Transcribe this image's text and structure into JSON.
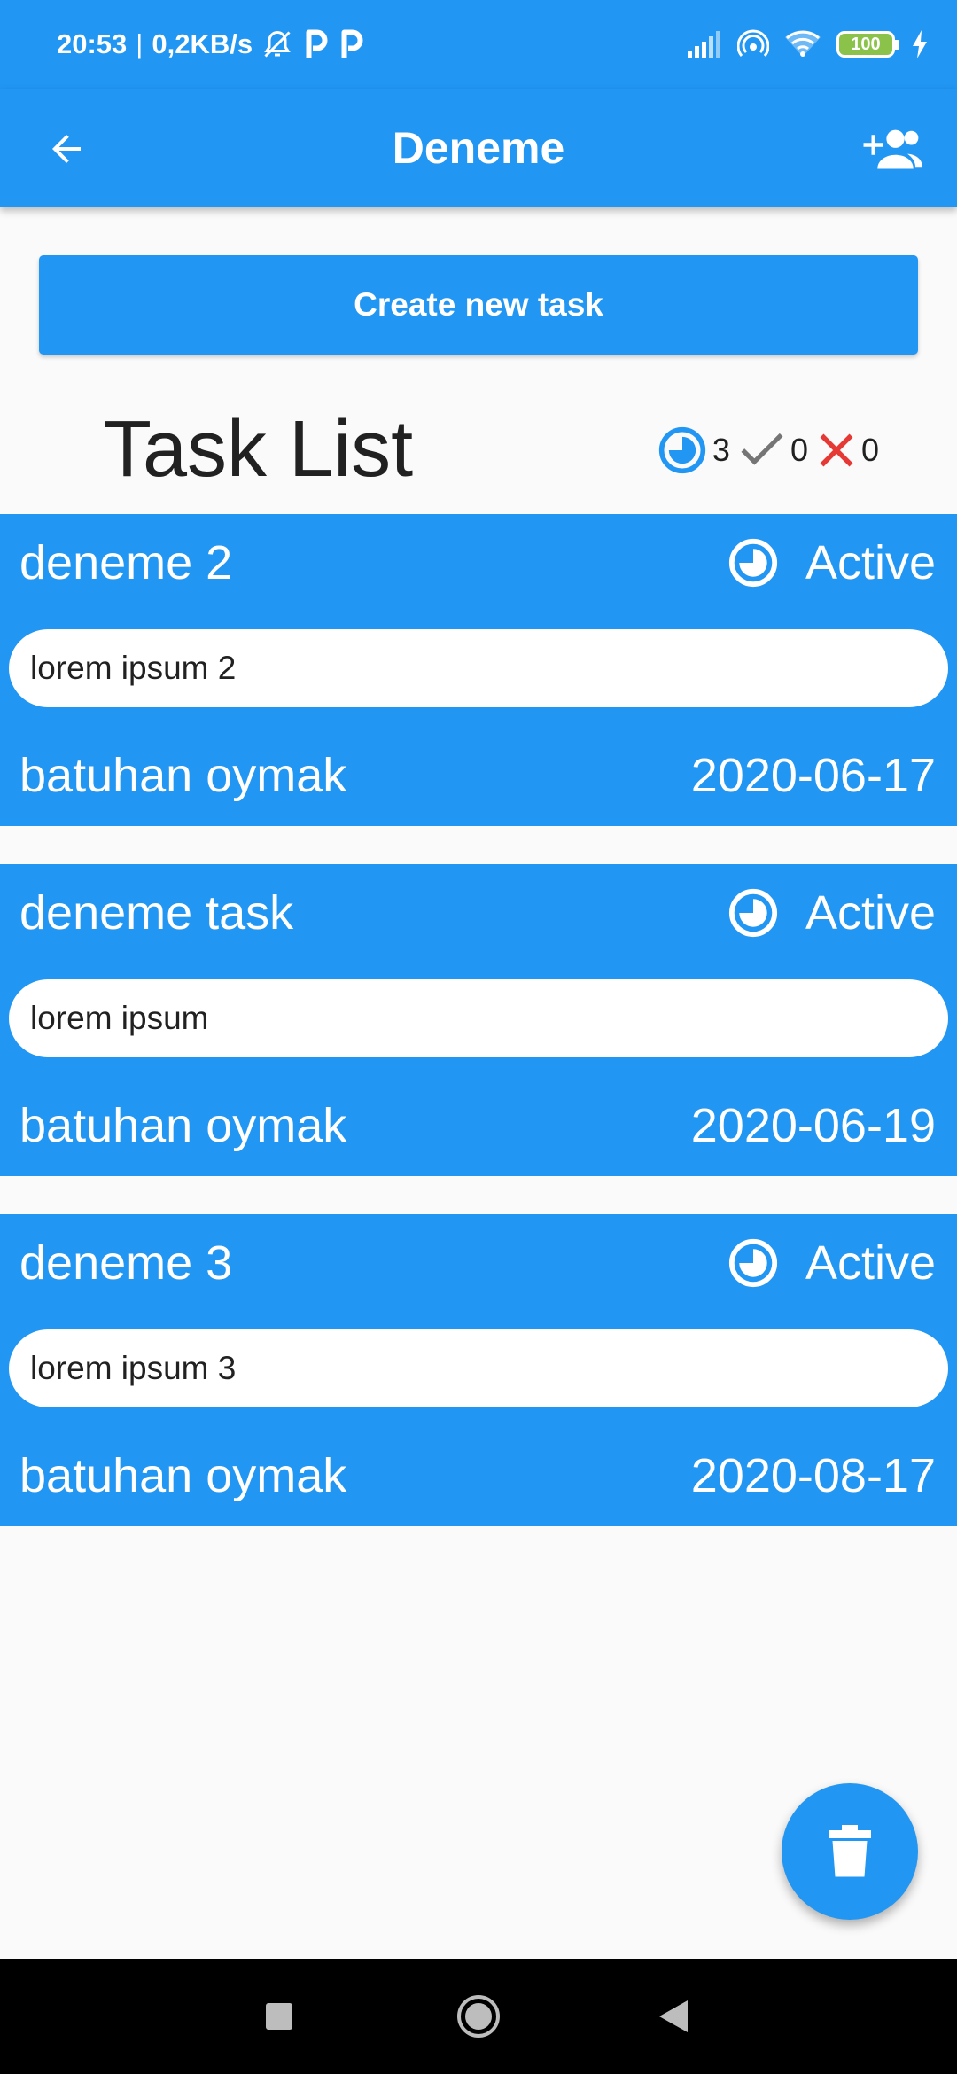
{
  "status_bar": {
    "time": "20:53",
    "separator": "|",
    "net_speed": "0,2KB/s",
    "battery": "100",
    "icons": [
      "silent-bell-icon",
      "p-notification-icon",
      "p-notification-icon",
      "signal-icon",
      "hotspot-icon",
      "wifi-icon",
      "battery-icon",
      "charging-icon"
    ]
  },
  "app_bar": {
    "title": "Deneme",
    "back_icon": "arrow-left-icon",
    "add_member_icon": "add-people-icon"
  },
  "create_button": {
    "label": "Create new task"
  },
  "task_list": {
    "title": "Task List",
    "counts": {
      "active": "3",
      "done": "0",
      "failed": "0"
    },
    "colors": {
      "active": "#2196f3",
      "done": "#757575",
      "failed": "#e53935"
    }
  },
  "tasks": [
    {
      "title": "deneme 2",
      "status": "Active",
      "description": "lorem ipsum 2",
      "owner": "batuhan oymak",
      "date": "2020-06-17"
    },
    {
      "title": "deneme task",
      "status": "Active",
      "description": "lorem ipsum",
      "owner": "batuhan oymak",
      "date": "2020-06-19"
    },
    {
      "title": "deneme 3",
      "status": "Active",
      "description": "lorem ipsum 3",
      "owner": "batuhan oymak",
      "date": "2020-08-17"
    }
  ],
  "fab": {
    "icon": "trash-icon"
  },
  "nav_bar": {
    "icons": [
      "recents-square-icon",
      "home-circle-icon",
      "back-triangle-icon"
    ]
  },
  "theme": {
    "primary": "#2196f3",
    "background": "#fafafa"
  }
}
